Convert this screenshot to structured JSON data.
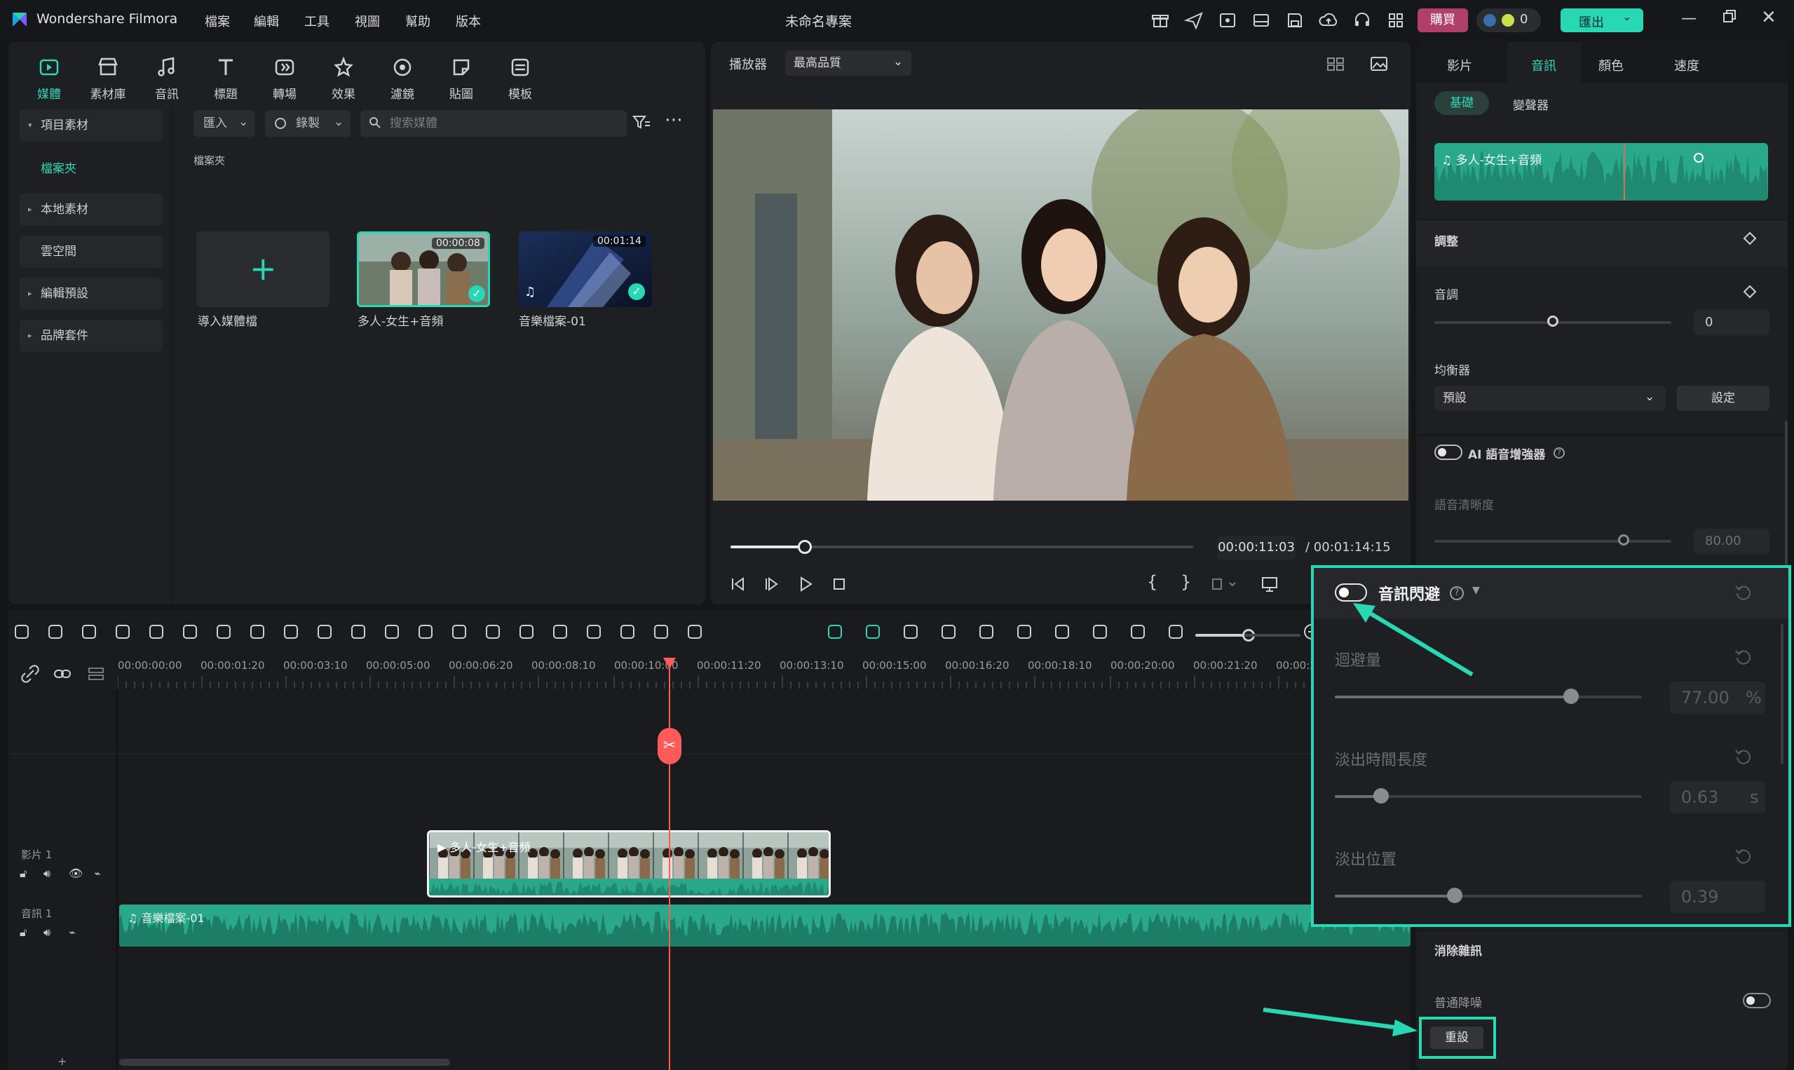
{
  "app": {
    "name": "Wondershare Filmora",
    "project_title": "未命名專案"
  },
  "menu": [
    "檔案",
    "編輯",
    "工具",
    "視圖",
    "幫助",
    "版本"
  ],
  "titlebar": {
    "buy_label": "購買",
    "points_value": "0",
    "export_label": "匯出"
  },
  "toolbar_tabs": [
    {
      "label": "媒體",
      "icon": "media-icon",
      "active": true
    },
    {
      "label": "素材庫",
      "icon": "store-icon"
    },
    {
      "label": "音訊",
      "icon": "music-note-icon"
    },
    {
      "label": "標題",
      "icon": "text-t-icon"
    },
    {
      "label": "轉場",
      "icon": "transition-icon"
    },
    {
      "label": "效果",
      "icon": "effects-icon"
    },
    {
      "label": "濾鏡",
      "icon": "filter-icon"
    },
    {
      "label": "貼圖",
      "icon": "sticker-icon"
    },
    {
      "label": "模板",
      "icon": "template-icon"
    }
  ],
  "sidebar": {
    "items": [
      {
        "label": "項目素材",
        "caret": "▾"
      },
      {
        "label": "檔案夾",
        "active": true
      },
      {
        "label": "本地素材",
        "caret": "▸"
      },
      {
        "label": "雲空間"
      },
      {
        "label": "編輯預設",
        "caret": "▸"
      },
      {
        "label": "品牌套件",
        "caret": "▸"
      }
    ]
  },
  "media_toolbar": {
    "import_label": "匯入",
    "record_label": "錄製",
    "search_placeholder": "搜索媒體"
  },
  "folder_label": "檔案夾",
  "media_items": [
    {
      "label": "導入媒體檔",
      "type": "import"
    },
    {
      "label": "多人-女生+音頻",
      "duration": "00:00:08",
      "type": "video"
    },
    {
      "label": "音樂檔案-01",
      "duration": "00:01:14",
      "type": "audio"
    }
  ],
  "player": {
    "label": "播放器",
    "quality": "最高品質",
    "current_time": "00:00:11:03",
    "total_time": "/ 00:01:14:15",
    "progress": 0.16
  },
  "right_panel": {
    "tabs": [
      "影片",
      "音訊",
      "顏色",
      "速度"
    ],
    "active_tab": "音訊",
    "subtabs": [
      "基礎",
      "變聲器"
    ],
    "active_subtab": "基礎",
    "clip_name": "多人-女生+音頻",
    "adjust_title": "調整",
    "pitch_label": "音調",
    "pitch_value": "0",
    "pitch_level": 0.5,
    "eq_label": "均衡器",
    "eq_preset": "預設",
    "eq_settings": "設定",
    "ai_voice_label": "AI 語音增強器",
    "clarity_label": "語音清晰度",
    "clarity_value": "80.00",
    "clarity_level": 0.8,
    "denoise_title": "消除雜訊",
    "normal_denoise": "普通降噪",
    "reset_label": "重設"
  },
  "ducking": {
    "title": "音訊閃避",
    "amount_label": "迴避量",
    "amount_value": "77.00",
    "amount_unit": "%",
    "amount_level": 0.77,
    "fadeout_label": "淡出時間長度",
    "fadeout_value": "0.63",
    "fadeout_unit": "s",
    "fadeout_level": 0.15,
    "position_label": "淡出位置",
    "position_value": "0.39",
    "position_level": 0.39
  },
  "timeline": {
    "ticks": [
      "00:00:00:00",
      "00:00:01:20",
      "00:00:03:10",
      "00:00:05:00",
      "00:00:06:20",
      "00:00:08:10",
      "00:00:10:00",
      "00:00:11:20",
      "00:00:13:10",
      "00:00:15:00",
      "00:00:16:20",
      "00:00:18:10",
      "00:00:20:00",
      "00:00:21:20",
      "00:00:2"
    ],
    "video_track_label": "影片 1",
    "audio_track_label": "音訊 1",
    "video_clip_label": "多人-女生+音頻",
    "audio_clip_label": "音樂檔案-01"
  },
  "accent_color": "#28d7b4",
  "buy_color": "#b0406a",
  "playhead_color": "#ff5a5a"
}
